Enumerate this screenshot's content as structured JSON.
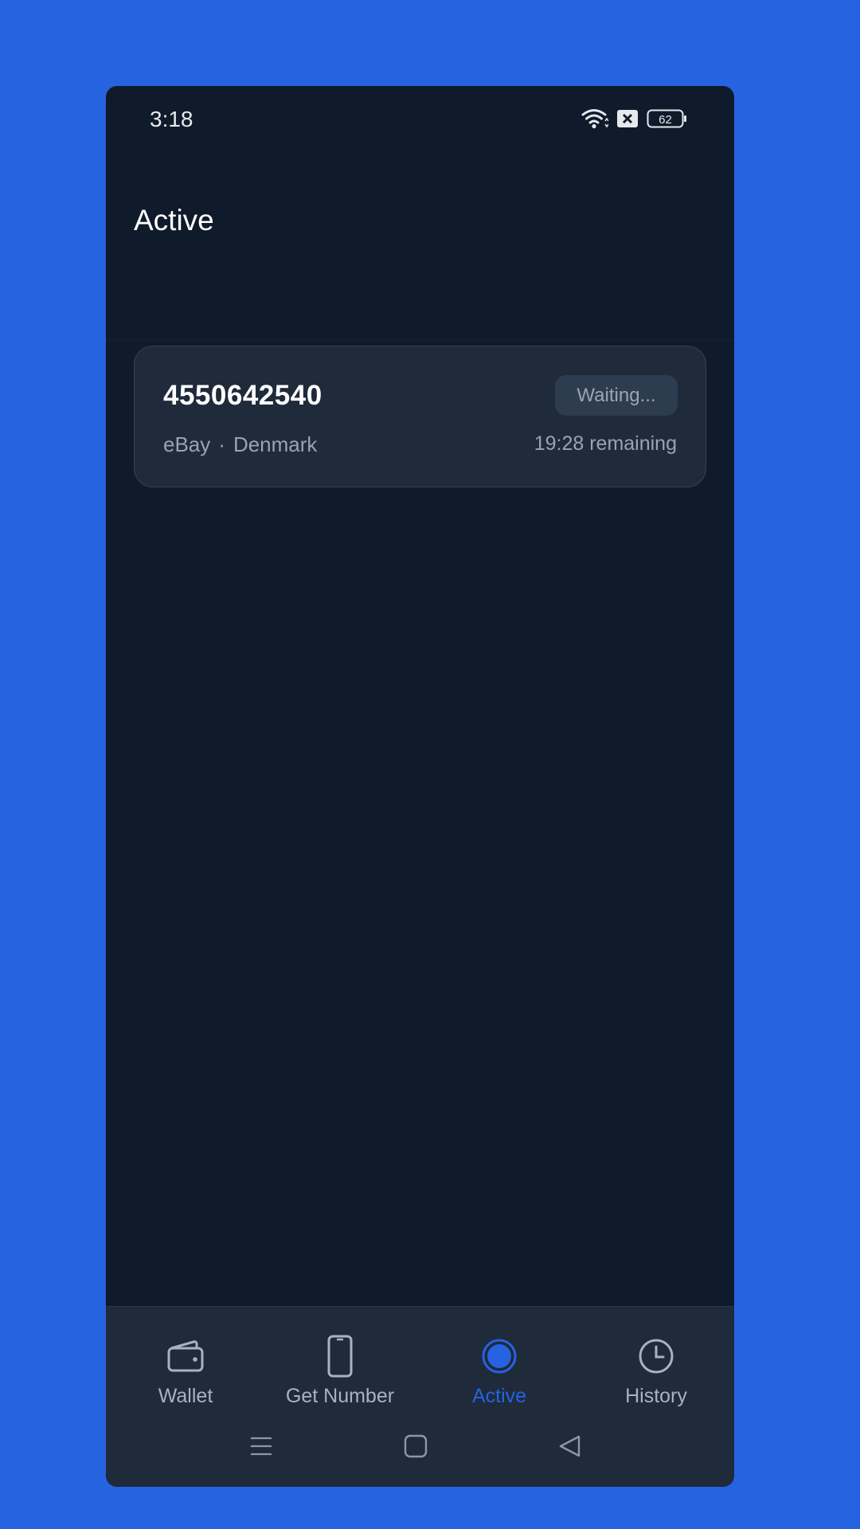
{
  "status_bar": {
    "time": "3:18",
    "battery": "62",
    "icons": [
      "wifi-icon",
      "sim-error-icon",
      "battery-icon"
    ]
  },
  "header": {
    "title": "Active"
  },
  "active_numbers": [
    {
      "number": "4550642540",
      "status": "Waiting...",
      "service": "eBay",
      "separator": "·",
      "country": "Denmark",
      "remaining": "19:28 remaining"
    }
  ],
  "bottom_nav": {
    "items": [
      {
        "label": "Wallet",
        "icon": "wallet-icon",
        "active": false
      },
      {
        "label": "Get Number",
        "icon": "phone-icon",
        "active": false
      },
      {
        "label": "Active",
        "icon": "active-dot-icon",
        "active": true
      },
      {
        "label": "History",
        "icon": "clock-icon",
        "active": false
      }
    ]
  },
  "system_nav": [
    "menu-icon",
    "home-icon",
    "back-icon"
  ],
  "colors": {
    "background": "#2563e0",
    "app_bg": "#0f1a2a",
    "card_bg": "#1f2a3b",
    "accent": "#2563e0"
  }
}
